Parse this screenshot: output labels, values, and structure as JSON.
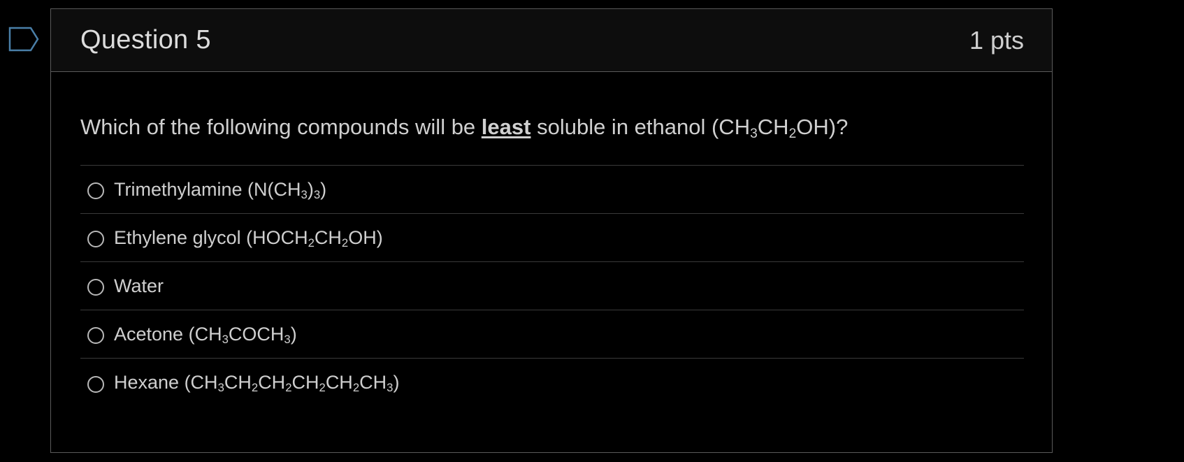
{
  "question": {
    "title": "Question 5",
    "points": "1 pts",
    "prompt_before": "Which of the following compounds will be ",
    "prompt_emphasis": "least",
    "prompt_after": " soluble in ethanol (CH",
    "prompt_formula": {
      "sub1": "3",
      "mid": "CH",
      "sub2": "2",
      "end": "OH)?"
    }
  },
  "answers": [
    {
      "parts": [
        "Trimethylamine (N(CH",
        "3",
        ")",
        "3",
        ")"
      ]
    },
    {
      "parts": [
        "Ethylene glycol (HOCH",
        "2",
        "CH",
        "2",
        "OH)"
      ]
    },
    {
      "parts": [
        "Water"
      ]
    },
    {
      "parts": [
        "Acetone (CH",
        "3",
        "COCH",
        "3",
        ")"
      ]
    },
    {
      "parts": [
        "Hexane (CH",
        "3",
        "CH",
        "2",
        "CH",
        "2",
        "CH",
        "2",
        "CH",
        "2",
        "CH",
        "3",
        ")"
      ]
    }
  ],
  "colors": {
    "background": "#000000",
    "border": "#5a5a5a",
    "text": "#d0d0d0"
  }
}
